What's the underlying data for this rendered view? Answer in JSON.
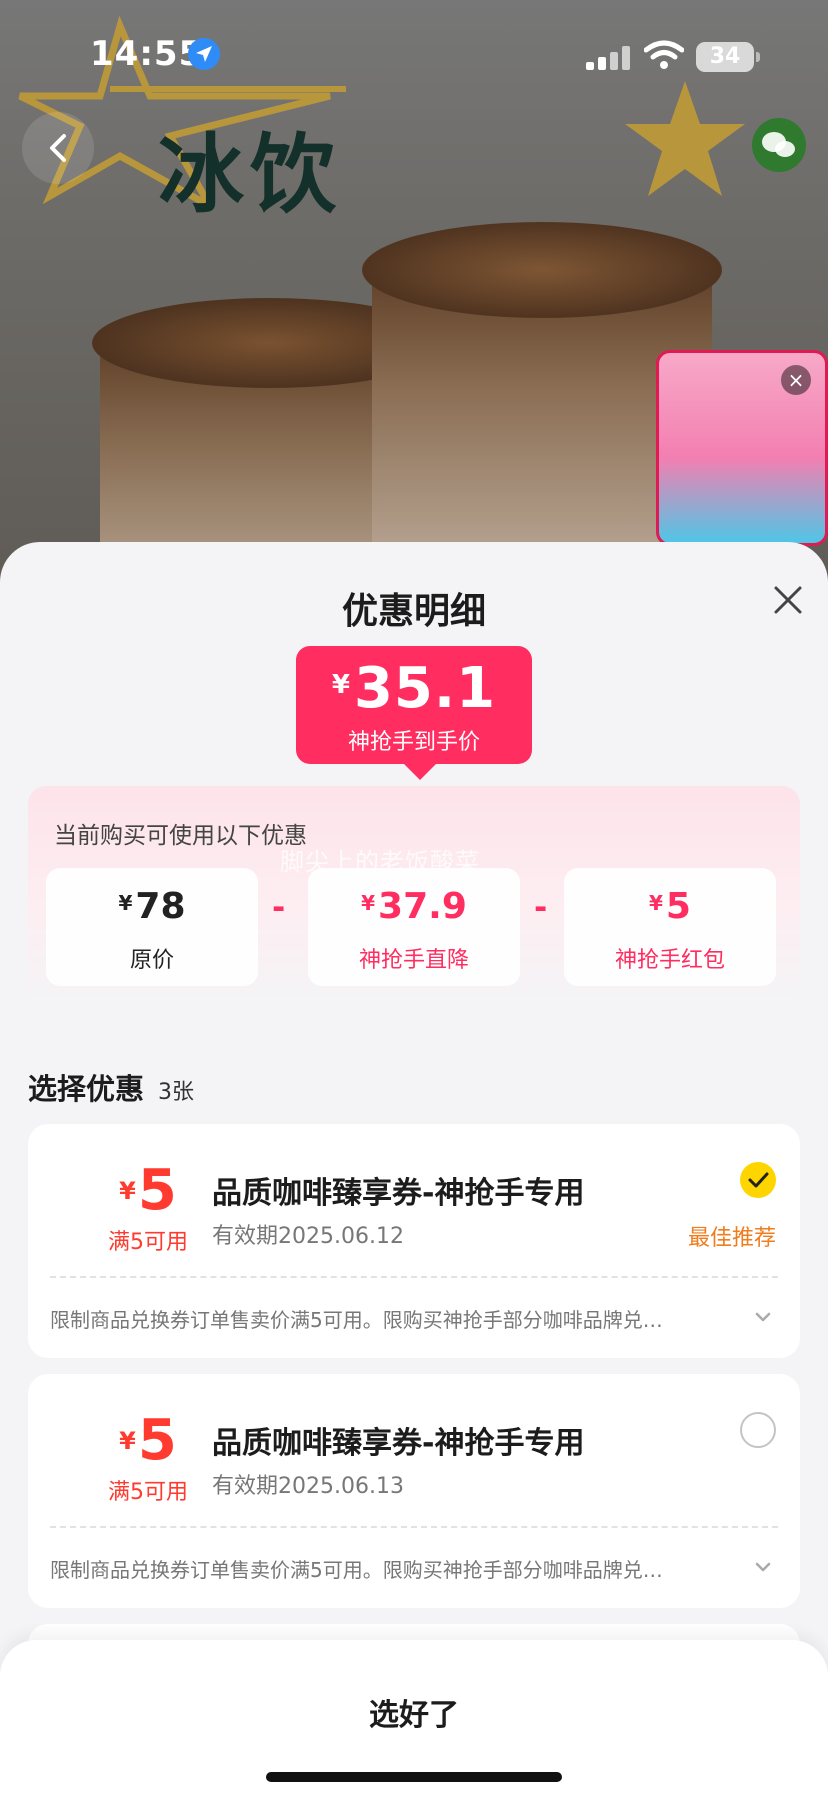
{
  "status_bar": {
    "time": "14:55",
    "battery": "34"
  },
  "background": {
    "title": "冰饮",
    "colors": {
      "title": "#14302a",
      "accent": "#b8963c"
    }
  },
  "sheet": {
    "title": "优惠明细",
    "final_price": {
      "currency": "¥",
      "value": "35.1",
      "label": "神抢手到手价"
    },
    "breakdown": {
      "caption": "当前购买可使用以下优惠",
      "watermark": "脚尖上的老饭酸菜",
      "operator": "-",
      "items": [
        {
          "currency": "¥",
          "value": "78",
          "label": "原价"
        },
        {
          "currency": "¥",
          "value": "37.9",
          "label": "神抢手直降"
        },
        {
          "currency": "¥",
          "value": "5",
          "label": "神抢手红包"
        }
      ]
    },
    "select_section": {
      "title": "选择优惠",
      "count": "3张"
    },
    "coupons": [
      {
        "currency": "¥",
        "value": "5",
        "condition": "满5可用",
        "name": "品质咖啡臻享券-神抢手专用",
        "expiry": "有效期2025.06.12",
        "selected": true,
        "tag": "最佳推荐",
        "description": "限制商品兑换券订单售卖价满5可用。限购买神抢手部分咖啡品牌兑…"
      },
      {
        "currency": "¥",
        "value": "5",
        "condition": "满5可用",
        "name": "品质咖啡臻享券-神抢手专用",
        "expiry": "有效期2025.06.13",
        "selected": false,
        "description": "限制商品兑换券订单售卖价满5可用。限购买神抢手部分咖啡品牌兑…"
      }
    ],
    "confirm_label": "选好了"
  },
  "theme": {
    "primary": "#ff2d60",
    "coupon_red": "#ff3a2e",
    "recommend": "#f07c1c",
    "check_yellow": "#ffd500"
  }
}
